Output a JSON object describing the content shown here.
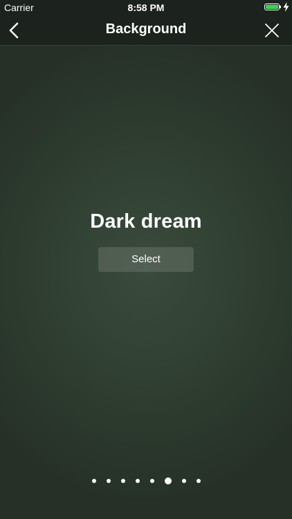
{
  "status_bar": {
    "carrier": "Carrier",
    "time": "8:58 PM",
    "battery_color": "#3fd34f"
  },
  "nav_bar": {
    "title": "Background",
    "back_icon": "chevron-left-icon",
    "close_icon": "close-icon"
  },
  "theme": {
    "name": "Dark dream",
    "select_label": "Select"
  },
  "pager": {
    "page_count": 8,
    "active_index": 5
  },
  "colors": {
    "background": "#304032",
    "bar": "#1c221d",
    "text": "#ffffff"
  }
}
